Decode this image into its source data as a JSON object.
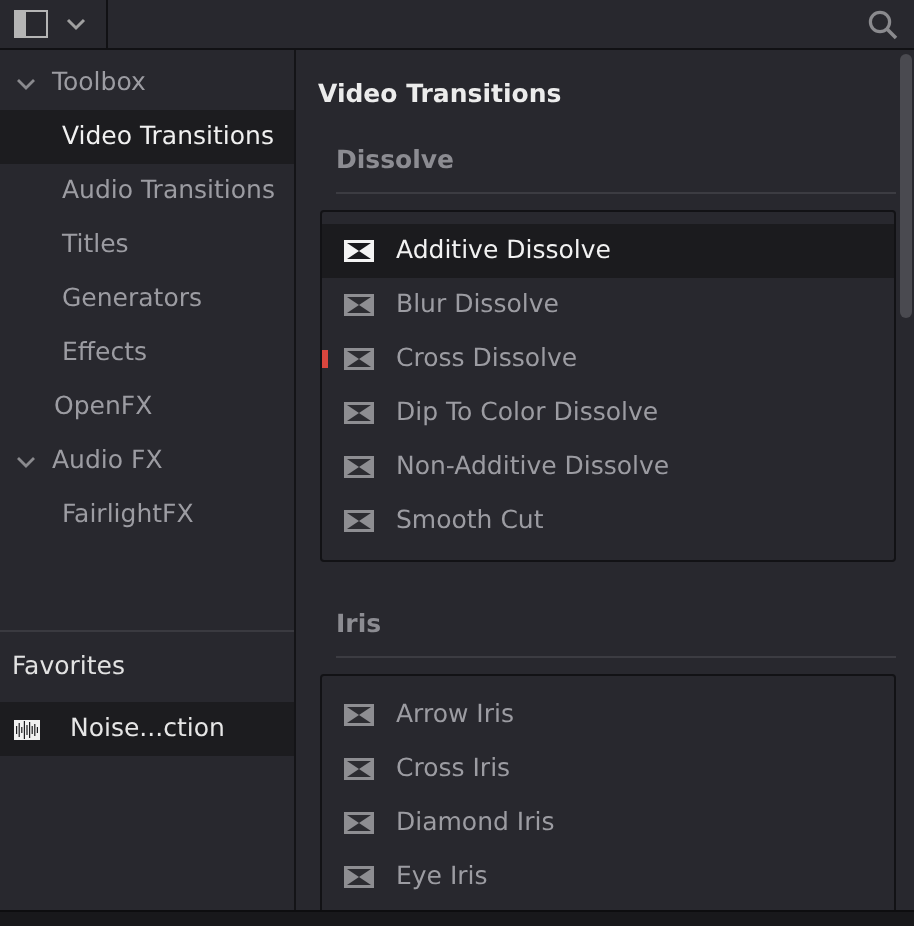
{
  "tree": [
    {
      "label": "Toolbox",
      "expanded": true,
      "selected": false,
      "children": [
        {
          "label": "Video Transitions",
          "selected": true
        },
        {
          "label": "Audio Transitions",
          "selected": false
        },
        {
          "label": "Titles",
          "selected": false
        },
        {
          "label": "Generators",
          "selected": false
        },
        {
          "label": "Effects",
          "selected": false
        }
      ]
    },
    {
      "label": "OpenFX",
      "selected": false
    },
    {
      "label": "Audio FX",
      "expanded": true,
      "selected": false,
      "children": [
        {
          "label": "FairlightFX",
          "selected": false
        }
      ]
    }
  ],
  "favorites": {
    "title": "Favorites",
    "items": [
      {
        "label": "Noise...ction",
        "selected": true
      }
    ]
  },
  "content": {
    "title": "Video Transitions",
    "groups": [
      {
        "title": "Dissolve",
        "items": [
          {
            "label": "Additive Dissolve",
            "selected": true,
            "marked": false
          },
          {
            "label": "Blur Dissolve",
            "selected": false,
            "marked": false
          },
          {
            "label": "Cross Dissolve",
            "selected": false,
            "marked": true
          },
          {
            "label": "Dip To Color Dissolve",
            "selected": false,
            "marked": false
          },
          {
            "label": "Non-Additive Dissolve",
            "selected": false,
            "marked": false
          },
          {
            "label": "Smooth Cut",
            "selected": false,
            "marked": false
          }
        ]
      },
      {
        "title": "Iris",
        "items": [
          {
            "label": "Arrow Iris",
            "selected": false,
            "marked": false
          },
          {
            "label": "Cross Iris",
            "selected": false,
            "marked": false
          },
          {
            "label": "Diamond Iris",
            "selected": false,
            "marked": false
          },
          {
            "label": "Eye Iris",
            "selected": false,
            "marked": false
          }
        ]
      }
    ]
  }
}
